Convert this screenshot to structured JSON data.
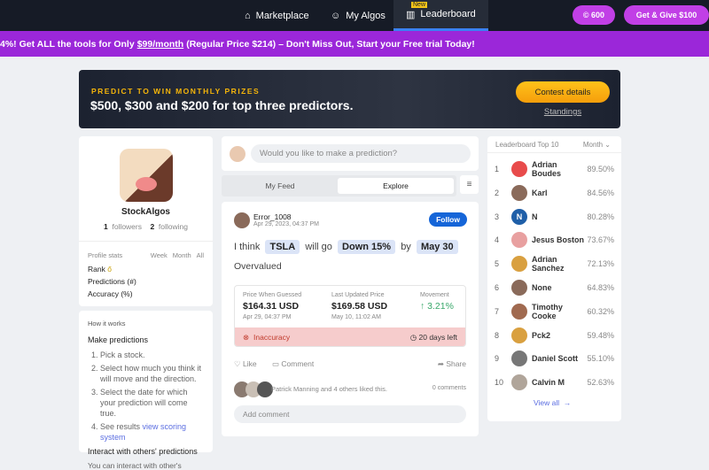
{
  "nav": {
    "items": [
      "Marketplace",
      "My Algos",
      "Leaderboard"
    ],
    "new_tag": "New",
    "coins": "600",
    "cta": "Get & Give $100"
  },
  "promo": {
    "prefix": "4%! Get ALL the tools for Only",
    "price_link": "$99/month",
    "suffix": "(Regular Price $214) – Don't Miss Out, Start your Free trial Today!"
  },
  "banner": {
    "kicker": "PREDICT TO WIN MONTHLY PRIZES",
    "headline": "$500, $300 and $200 for top three predictors.",
    "button": "Contest details",
    "link": "Standings"
  },
  "profile": {
    "name": "StockAlgos",
    "followers": "1",
    "followers_label": "followers",
    "following": "2",
    "following_label": "following",
    "stats_label": "Profile stats",
    "periods": [
      "Week",
      "Month",
      "All"
    ],
    "rank": "Rank",
    "predictions": "Predictions (#)",
    "accuracy": "Accuracy (%)"
  },
  "how": {
    "title": "How it works",
    "h1": "Make predictions",
    "steps": [
      "Pick a stock.",
      "Select how much you think it will move and the direction.",
      "Select the date for which your prediction will come true.",
      "See results"
    ],
    "scoring_link": "view scoring system",
    "h2": "Interact with others' predictions",
    "p2": "You can interact with other's"
  },
  "composer": {
    "placeholder": "Would you like to make a prediction?"
  },
  "tabs": [
    "My Feed",
    "Explore"
  ],
  "post": {
    "user": "Error_1008",
    "date": "Apr 29, 2023, 04:37 PM",
    "follow": "Follow",
    "t1": "I think",
    "ticker": "TSLA",
    "t2": "will go",
    "move": "Down 15%",
    "t3": "by",
    "target": "May 30",
    "note": "Overvalued",
    "guessed_label": "Price When Guessed",
    "guessed": "$164.31 USD",
    "guessed_date": "Apr 29, 04:37 PM",
    "last_label": "Last Updated Price",
    "last": "$169.58 USD",
    "last_date": "May 10, 11:02 AM",
    "movement_label": "Movement",
    "movement": "↑ 3.21%",
    "status": "Inaccuracy",
    "days_left": "20 days left",
    "like": "Like",
    "comment": "Comment",
    "share": "Share",
    "likes_text": "Patrick Manning and 4 others liked this.",
    "comments": "0 comments",
    "add_comment": "Add comment"
  },
  "leaderboard": {
    "title": "Leaderboard Top 10",
    "period": "Month",
    "view_all": "View all",
    "rows": [
      {
        "rank": "1",
        "name": "Adrian Boudes",
        "pct": "89.50%",
        "color": "#e84b4b"
      },
      {
        "rank": "2",
        "name": "Karl",
        "pct": "84.56%",
        "color": "#8a6a5a"
      },
      {
        "rank": "3",
        "name": "N",
        "pct": "80.28%",
        "color": "#1f5fa8"
      },
      {
        "rank": "4",
        "name": "Jesus Boston",
        "pct": "73.67%",
        "color": "#e8a0a0"
      },
      {
        "rank": "5",
        "name": "Adrian Sanchez",
        "pct": "72.13%",
        "color": "#d9a040"
      },
      {
        "rank": "6",
        "name": "None",
        "pct": "64.83%",
        "color": "#8a6a5a"
      },
      {
        "rank": "7",
        "name": "Timothy Cooke",
        "pct": "60.32%",
        "color": "#a06a50"
      },
      {
        "rank": "8",
        "name": "Pck2",
        "pct": "59.48%",
        "color": "#d9a040"
      },
      {
        "rank": "9",
        "name": "Daniel Scott",
        "pct": "55.10%",
        "color": "#777"
      },
      {
        "rank": "10",
        "name": "Calvin M",
        "pct": "52.63%",
        "color": "#b0a59a"
      }
    ]
  }
}
